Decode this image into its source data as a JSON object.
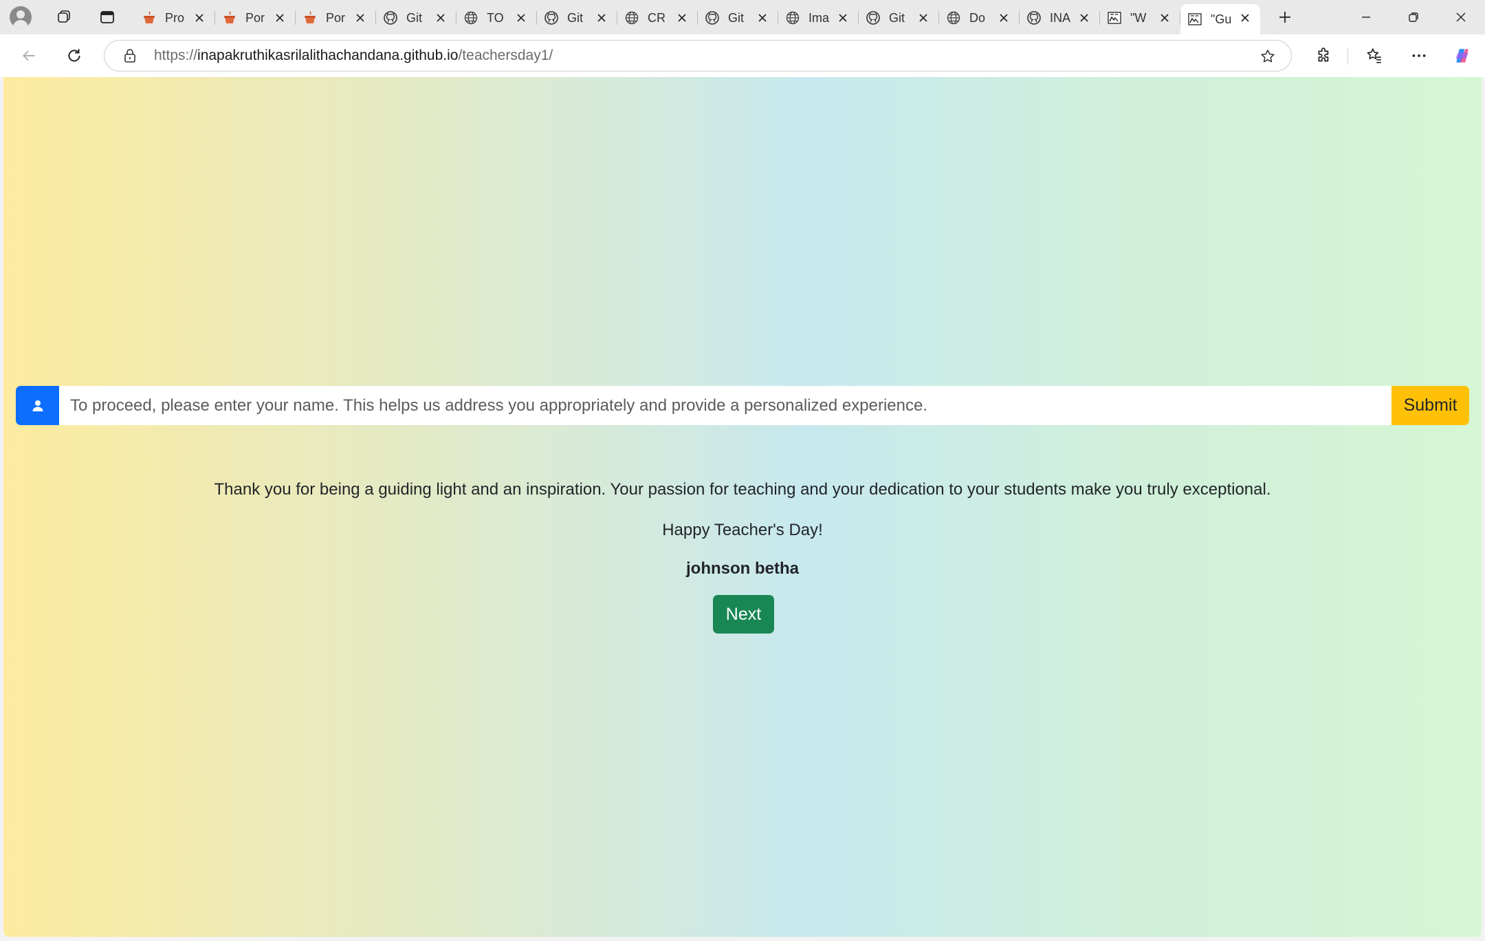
{
  "browser": {
    "tabs": [
      {
        "icon": "pot-icon",
        "label": "Pro"
      },
      {
        "icon": "pot-icon",
        "label": "Por"
      },
      {
        "icon": "pot-icon",
        "label": "Por"
      },
      {
        "icon": "github-icon",
        "label": "Git"
      },
      {
        "icon": "globe-icon",
        "label": "TO"
      },
      {
        "icon": "github-icon",
        "label": "Git"
      },
      {
        "icon": "globe-icon",
        "label": "CR"
      },
      {
        "icon": "github-icon",
        "label": "Git"
      },
      {
        "icon": "globe-icon",
        "label": "Ima"
      },
      {
        "icon": "github-icon",
        "label": "Git"
      },
      {
        "icon": "globe-icon",
        "label": "Do"
      },
      {
        "icon": "github-icon",
        "label": "INA"
      },
      {
        "icon": "sketch-icon",
        "label": "\"W"
      },
      {
        "icon": "sketch-icon",
        "label": "\"Gu",
        "active": true
      }
    ],
    "url": {
      "scheme": "https://",
      "host": "inapakruthikasrilalithachandana.github.io",
      "path": "/teachersday1/"
    }
  },
  "page": {
    "name_input": {
      "placeholder": "To proceed, please enter your name. This helps us address you appropriately and provide a personalized experience.",
      "value": ""
    },
    "submit_label": "Submit",
    "message": "Thank you for being a guiding light and an inspiration. Your passion for teaching and your dedication to your students make you truly exceptional.",
    "greeting": "Happy Teacher's Day!",
    "teacher_name": "johnson betha",
    "next_label": "Next",
    "colors": {
      "primary": "#0d6efd",
      "warning": "#ffc107",
      "success": "#198754"
    }
  }
}
